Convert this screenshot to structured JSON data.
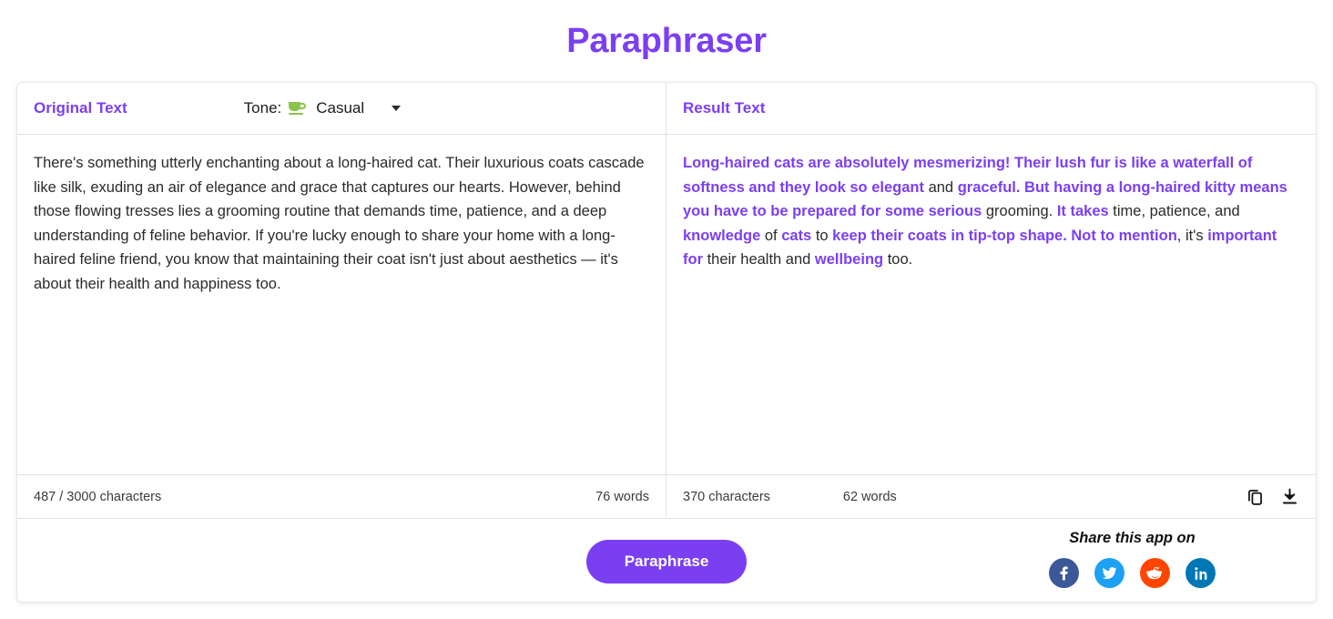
{
  "header": {
    "title": "Paraphraser",
    "accent_color": "#7b3ff2"
  },
  "original_panel": {
    "title": "Original Text",
    "tone": {
      "label": "Tone:",
      "value": "Casual",
      "icon": "coffee-cup-icon",
      "icon_color": "#8bc34a"
    },
    "text": "There's something utterly enchanting about a long-haired cat. Their luxurious coats cascade like silk, exuding an air of elegance and grace that captures our hearts. However, behind those flowing tresses lies a grooming routine that demands time, patience, and a deep understanding of feline behavior. If you're lucky enough to share your home with a long-haired feline friend, you know that maintaining their coat isn't just about aesthetics — it's about their health and happiness too.",
    "char_count": "487 / 3000 characters",
    "word_count": "76 words"
  },
  "result_panel": {
    "title": "Result Text",
    "segments": [
      {
        "text": "Long-haired cats are absolutely mesmerizing! Their lush fur is like a waterfall of softness and they look so elegant",
        "highlight": true
      },
      {
        "text": " and ",
        "highlight": false
      },
      {
        "text": "graceful. But having a long-haired kitty means you have to be prepared for some serious",
        "highlight": true
      },
      {
        "text": " grooming. ",
        "highlight": false
      },
      {
        "text": "It takes",
        "highlight": true
      },
      {
        "text": " time, patience, and ",
        "highlight": false
      },
      {
        "text": "knowledge",
        "highlight": true
      },
      {
        "text": " of ",
        "highlight": false
      },
      {
        "text": "cats",
        "highlight": true
      },
      {
        "text": " to ",
        "highlight": false
      },
      {
        "text": "keep their coats in tip-top shape. Not to mention",
        "highlight": true
      },
      {
        "text": ", it's ",
        "highlight": false
      },
      {
        "text": "important for",
        "highlight": true
      },
      {
        "text": " their health and ",
        "highlight": false
      },
      {
        "text": "wellbeing",
        "highlight": true
      },
      {
        "text": " too.",
        "highlight": false
      }
    ],
    "char_count": "370 characters",
    "word_count": "62 words",
    "actions": [
      {
        "name": "copy-icon",
        "title": "Copy"
      },
      {
        "name": "download-icon",
        "title": "Download"
      }
    ]
  },
  "bottom_bar": {
    "paraphrase_button": "Paraphrase",
    "share_title": "Share this app on",
    "socials": [
      {
        "name": "facebook",
        "glyph": "f",
        "color": "#3b5998"
      },
      {
        "name": "twitter",
        "glyph": "",
        "color": "#1da1f2"
      },
      {
        "name": "reddit",
        "glyph": "",
        "color": "#ff4500"
      },
      {
        "name": "linkedin",
        "glyph": "in",
        "color": "#0077b5"
      }
    ]
  }
}
